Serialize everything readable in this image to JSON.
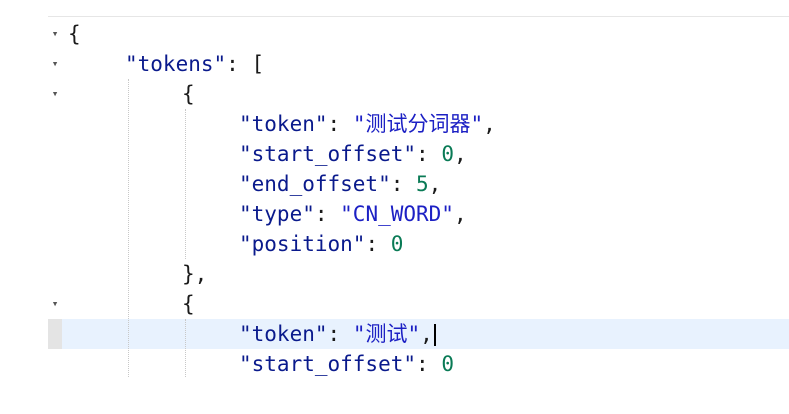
{
  "editor": {
    "lines": [
      {
        "parts": [
          {
            "t": "punct",
            "v": "{"
          }
        ],
        "fold": true,
        "indent": 0
      },
      {
        "parts": [
          {
            "t": "key",
            "v": "\"tokens\""
          },
          {
            "t": "punct",
            "v": ": ["
          }
        ],
        "fold": true,
        "indent": 1
      },
      {
        "parts": [
          {
            "t": "punct",
            "v": "{"
          }
        ],
        "fold": true,
        "indent": 2
      },
      {
        "parts": [
          {
            "t": "key",
            "v": "\"token\""
          },
          {
            "t": "punct",
            "v": ": "
          },
          {
            "t": "str",
            "v": "\"测试分词器\""
          },
          {
            "t": "punct",
            "v": ","
          }
        ],
        "fold": false,
        "indent": 3
      },
      {
        "parts": [
          {
            "t": "key",
            "v": "\"start_offset\""
          },
          {
            "t": "punct",
            "v": ": "
          },
          {
            "t": "num",
            "v": "0"
          },
          {
            "t": "punct",
            "v": ","
          }
        ],
        "fold": false,
        "indent": 3
      },
      {
        "parts": [
          {
            "t": "key",
            "v": "\"end_offset\""
          },
          {
            "t": "punct",
            "v": ": "
          },
          {
            "t": "num",
            "v": "5"
          },
          {
            "t": "punct",
            "v": ","
          }
        ],
        "fold": false,
        "indent": 3
      },
      {
        "parts": [
          {
            "t": "key",
            "v": "\"type\""
          },
          {
            "t": "punct",
            "v": ": "
          },
          {
            "t": "str",
            "v": "\"CN_WORD\""
          },
          {
            "t": "punct",
            "v": ","
          }
        ],
        "fold": false,
        "indent": 3
      },
      {
        "parts": [
          {
            "t": "key",
            "v": "\"position\""
          },
          {
            "t": "punct",
            "v": ": "
          },
          {
            "t": "num",
            "v": "0"
          }
        ],
        "fold": false,
        "indent": 3
      },
      {
        "parts": [
          {
            "t": "punct",
            "v": "},"
          }
        ],
        "fold": false,
        "indent": 2
      },
      {
        "parts": [
          {
            "t": "punct",
            "v": "{"
          }
        ],
        "fold": true,
        "indent": 2
      },
      {
        "parts": [
          {
            "t": "key",
            "v": "\"token\""
          },
          {
            "t": "punct",
            "v": ": "
          },
          {
            "t": "str",
            "v": "\"测试\""
          },
          {
            "t": "punct",
            "v": ","
          }
        ],
        "fold": false,
        "indent": 3,
        "active": true,
        "cursor": true
      },
      {
        "parts": [
          {
            "t": "key",
            "v": "\"start_offset\""
          },
          {
            "t": "punct",
            "v": ": "
          },
          {
            "t": "num",
            "v": "0"
          }
        ],
        "fold": false,
        "indent": 3
      }
    ]
  },
  "colors": {
    "key": "#0a1a8c",
    "string": "#1c20c4",
    "number": "#097a55",
    "active_line": "#e8f2fe"
  },
  "icons": {
    "fold": "triangle-down-icon"
  }
}
